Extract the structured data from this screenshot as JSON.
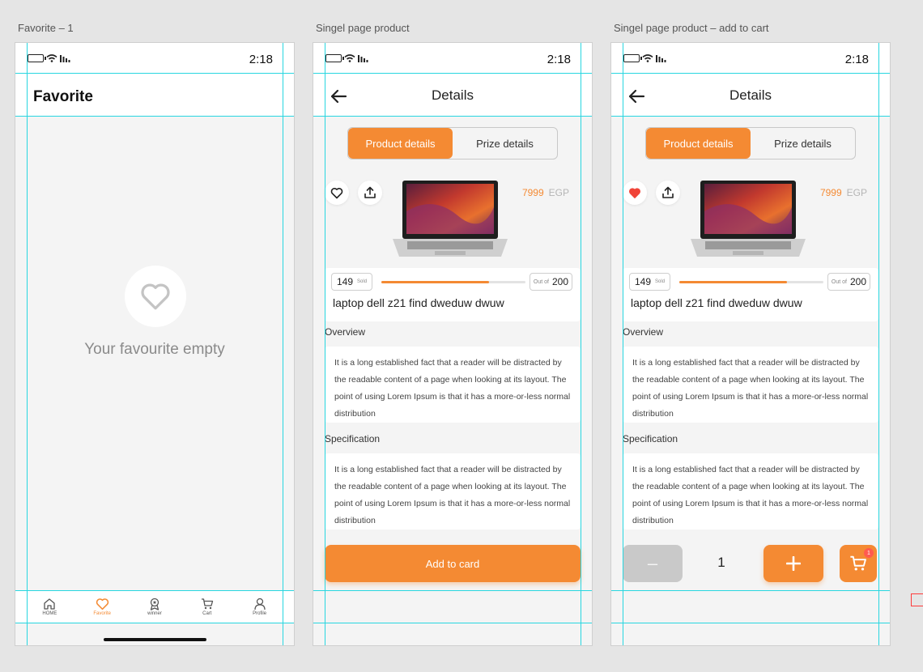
{
  "frames": {
    "favorite": {
      "frame_title": "Favorite – 1",
      "time": "2:18",
      "page_title": "Favorite",
      "empty_text": "Your favourite empty",
      "nav": [
        {
          "label": "HOME",
          "icon": "home-icon"
        },
        {
          "label": "Favorite",
          "icon": "heart-icon"
        },
        {
          "label": "winner",
          "icon": "award-icon"
        },
        {
          "label": "Cart",
          "icon": "cart-icon"
        },
        {
          "label": "Profile",
          "icon": "profile-icon"
        }
      ]
    },
    "product": {
      "frame_title": "Singel page product",
      "time": "2:18",
      "header_title": "Details",
      "tabs": [
        "Product details",
        "Prize details"
      ],
      "price": "7999",
      "currency": "EGP",
      "sold": "149",
      "sold_label": "Sold",
      "out_of_label": "Out of",
      "total": "200",
      "progress_fraction": 0.745,
      "product_name": "laptop dell z21 find dweduw dwuw",
      "overview_label": "Overview",
      "overview_text": "It is a long established fact that a reader will be distracted by the readable content of a page when looking at its layout. The point of using Lorem Ipsum is that it has a more-or-less normal distribution",
      "spec_label": "Specification",
      "spec_text": "It is a long established fact that a reader will be distracted by the readable content of a page when looking at its layout. The point of using Lorem Ipsum is that it has a more-or-less normal distribution",
      "add_button": "Add to card"
    },
    "product_cart": {
      "frame_title": "Singel page product – add to cart",
      "time": "2:18",
      "header_title": "Details",
      "tabs": [
        "Product details",
        "Prize details"
      ],
      "price": "7999",
      "currency": "EGP",
      "sold": "149",
      "sold_label": "Sold",
      "out_of_label": "Out of",
      "total": "200",
      "progress_fraction": 0.745,
      "product_name": "laptop dell z21 find dweduw dwuw",
      "overview_label": "Overview",
      "overview_text": "It is a long established fact that a reader will be distracted by the readable content of a page when looking at its layout. The point of using Lorem Ipsum is that it has a more-or-less normal distribution",
      "spec_label": "Specification",
      "spec_text": "It is a long established fact that a reader will be distracted by the readable content of a page when looking at its layout. The point of using Lorem Ipsum is that it has a more-or-less normal distribution",
      "minus_label": "–",
      "quantity": "1",
      "cart_badge": "1",
      "favorited": true
    }
  },
  "colors": {
    "accent": "#f48a33",
    "guide": "#28d6e0",
    "heart_filled": "#f04438",
    "badge": "#ff5a4e"
  }
}
